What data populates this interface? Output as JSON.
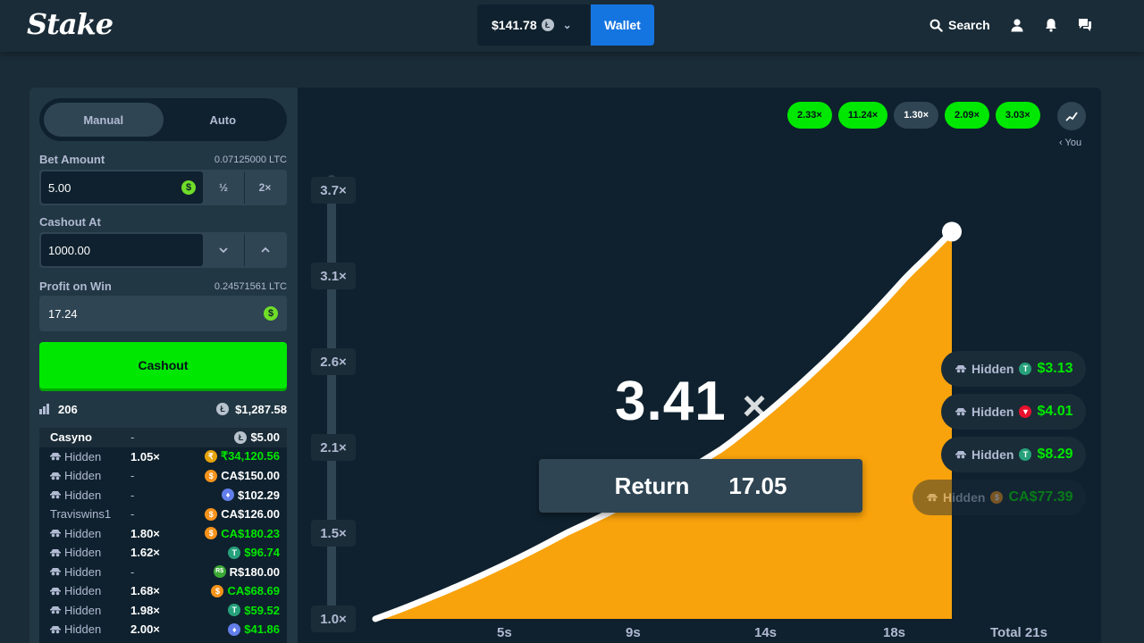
{
  "header": {
    "logo": "Stake",
    "balance": "$141.78",
    "wallet_label": "Wallet",
    "search_label": "Search"
  },
  "controls": {
    "tabs": [
      {
        "label": "Manual",
        "active": true
      },
      {
        "label": "Auto",
        "active": false
      }
    ],
    "bet_amount": {
      "label": "Bet Amount",
      "aside": "0.07125000 LTC",
      "value": "5.00",
      "half": "½",
      "double": "2×"
    },
    "cashout_at": {
      "label": "Cashout At",
      "value": "1000.00"
    },
    "profit_on_win": {
      "label": "Profit on Win",
      "aside": "0.24571561 LTC",
      "value": "17.24"
    },
    "cashout_label": "Cashout"
  },
  "stats": {
    "players": "206",
    "total": "$1,287.58"
  },
  "players": [
    {
      "name": "Casyno",
      "mult": "-",
      "amount": "$5.00",
      "currency": "ltc",
      "hidden": false,
      "won": false
    },
    {
      "name": "Hidden",
      "mult": "1.05×",
      "amount": "₹34,120.56",
      "currency": "inr",
      "hidden": true,
      "won": true
    },
    {
      "name": "Hidden",
      "mult": "-",
      "amount": "CA$150.00",
      "currency": "btc",
      "hidden": true,
      "won": false
    },
    {
      "name": "Hidden",
      "mult": "-",
      "amount": "$102.29",
      "currency": "eth",
      "hidden": true,
      "won": false
    },
    {
      "name": "Traviswins1",
      "mult": "-",
      "amount": "CA$126.00",
      "currency": "btc",
      "hidden": false,
      "won": false
    },
    {
      "name": "Hidden",
      "mult": "1.80×",
      "amount": "CA$180.23",
      "currency": "btc",
      "hidden": true,
      "won": true
    },
    {
      "name": "Hidden",
      "mult": "1.62×",
      "amount": "$96.74",
      "currency": "usdt",
      "hidden": true,
      "won": true
    },
    {
      "name": "Hidden",
      "mult": "-",
      "amount": "R$180.00",
      "currency": "brl",
      "hidden": true,
      "won": false
    },
    {
      "name": "Hidden",
      "mult": "1.68×",
      "amount": "CA$68.69",
      "currency": "btc",
      "hidden": true,
      "won": true
    },
    {
      "name": "Hidden",
      "mult": "1.98×",
      "amount": "$59.52",
      "currency": "usdt",
      "hidden": true,
      "won": true
    },
    {
      "name": "Hidden",
      "mult": "2.00×",
      "amount": "$41.86",
      "currency": "eth",
      "hidden": true,
      "won": true
    }
  ],
  "history": [
    {
      "value": "2.33×",
      "style": "green"
    },
    {
      "value": "11.24×",
      "style": "green"
    },
    {
      "value": "1.30×",
      "style": "grey"
    },
    {
      "value": "2.09×",
      "style": "green"
    },
    {
      "value": "3.03×",
      "style": "green"
    }
  ],
  "you_label": "‹ You",
  "game": {
    "multiplier": "3.41",
    "multiplier_suffix": "×",
    "return_label": "Return",
    "return_value": "17.05"
  },
  "chart_data": {
    "type": "area",
    "y_ticks": [
      "3.7×",
      "3.1×",
      "2.6×",
      "2.1×",
      "1.5×",
      "1.0×"
    ],
    "x_ticks": [
      "5s",
      "9s",
      "14s",
      "18s",
      "Total 21s"
    ],
    "ylim": [
      1.0,
      3.7
    ],
    "xlim": [
      0,
      21
    ],
    "current": {
      "t": 21,
      "multiplier": 3.41
    },
    "growth": "exponential"
  },
  "cashouts": [
    {
      "name": "Hidden",
      "amount": "$3.13",
      "currency": "usdt",
      "faded": false
    },
    {
      "name": "Hidden",
      "amount": "$4.01",
      "currency": "trx",
      "faded": false
    },
    {
      "name": "Hidden",
      "amount": "$8.29",
      "currency": "usdt",
      "faded": false
    },
    {
      "name": "Hidden",
      "amount": "CA$77.39",
      "currency": "btc",
      "faded": true
    }
  ],
  "colors": {
    "accent_green": "#00e701",
    "fill_orange": "#f8a20c",
    "wallet_blue": "#1475e1",
    "panel": "#213743",
    "bg": "#0f212e"
  }
}
